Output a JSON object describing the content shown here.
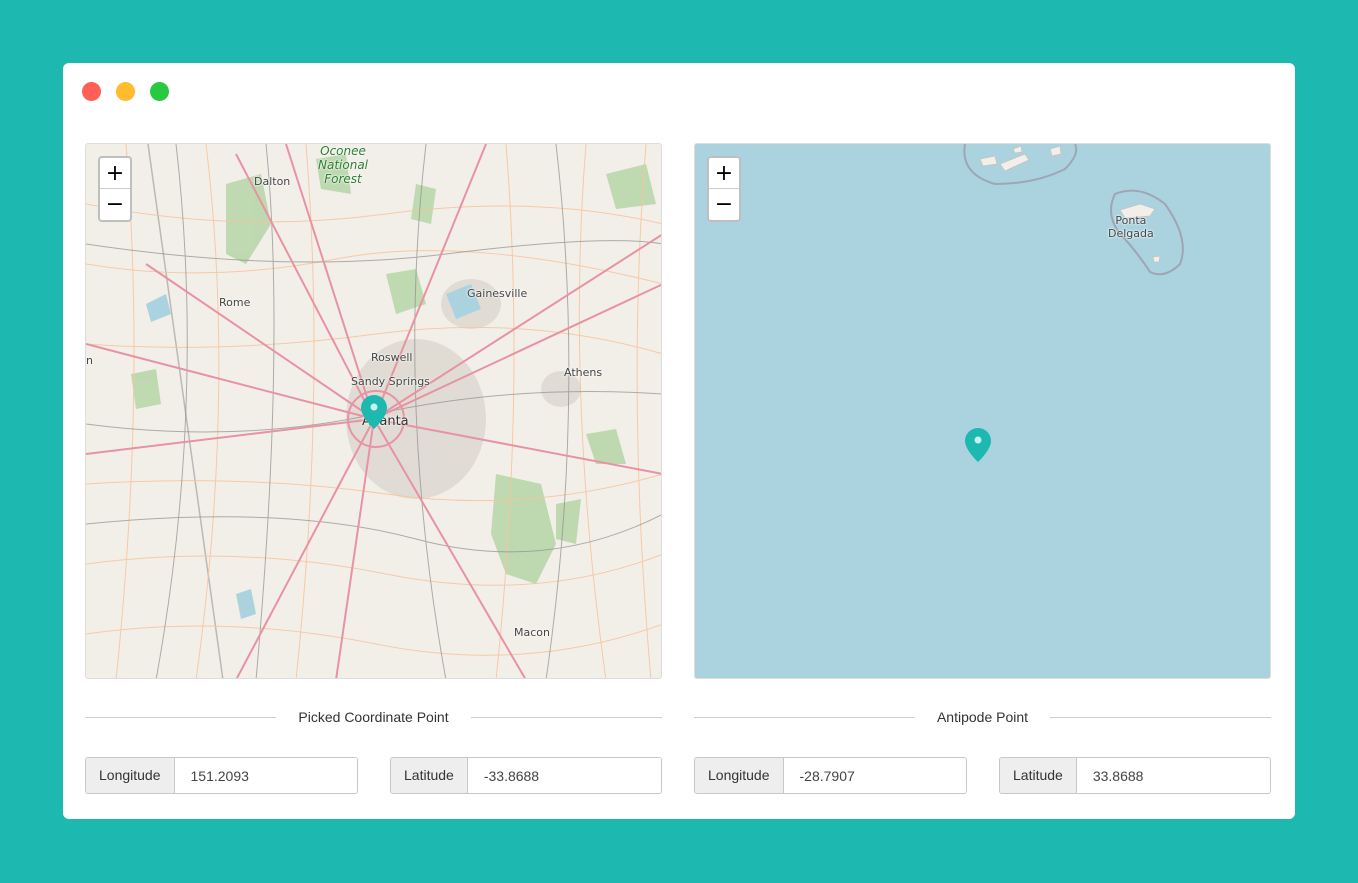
{
  "window": {
    "controls": [
      "close",
      "minimize",
      "maximize"
    ]
  },
  "picked_map": {
    "zoom_in": "+",
    "zoom_out": "−",
    "forest_label": [
      "Oconee",
      "National",
      "Forest"
    ],
    "places": {
      "dalton": "Dalton",
      "rome": "Rome",
      "gainesville": "Gainesville",
      "roswell": "Roswell",
      "sandy_springs": "Sandy Springs",
      "athens": "Athens",
      "atlanta": "Atlanta",
      "macon": "Macon",
      "edge": "n"
    },
    "marker_icon": "map-marker-icon"
  },
  "antipode_map": {
    "zoom_in": "+",
    "zoom_out": "−",
    "places": {
      "ponta_delgada": [
        "Ponta",
        "Delgada"
      ]
    },
    "marker_icon": "map-marker-icon"
  },
  "picked_section": {
    "title": "Picked Coordinate Point",
    "longitude_label": "Longitude",
    "longitude_value": "151.2093",
    "latitude_label": "Latitude",
    "latitude_value": "-33.8688"
  },
  "antipode_section": {
    "title": "Antipode Point",
    "longitude_label": "Longitude",
    "longitude_value": "-28.7907",
    "latitude_label": "Latitude",
    "latitude_value": "33.8688"
  },
  "colors": {
    "accent": "#1db9b1",
    "ocean": "#aad3df",
    "land": "#f2efe9"
  }
}
